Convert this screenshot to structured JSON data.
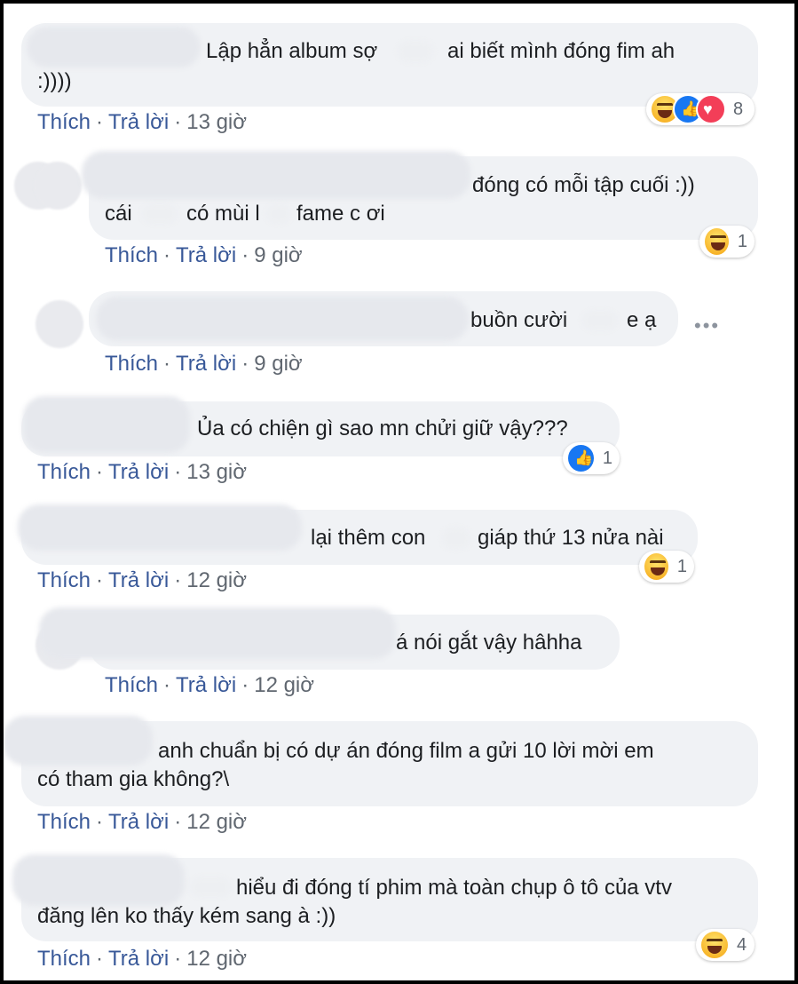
{
  "actions": {
    "like": "Thích",
    "reply": "Trả lời",
    "separator": "·"
  },
  "comments": [
    {
      "lines": [
        "Lập hẳn album sợ",
        "ai biết mình đóng fim ah",
        ":))))"
      ],
      "time": "13 giờ",
      "reactions": {
        "icons": [
          "haha",
          "like",
          "love"
        ],
        "count": "8"
      }
    },
    {
      "lines": [
        "đóng có mỗi tập cuối :))",
        "cái",
        "có mùi l",
        "fame c ơi"
      ],
      "time": "9 giờ",
      "reactions": {
        "icons": [
          "haha"
        ],
        "count": "1"
      }
    },
    {
      "lines": [
        "buồn cười",
        "e ạ"
      ],
      "time": "9 giờ",
      "more": "•••"
    },
    {
      "lines": [
        "Ủa có chiện gì sao mn chửi giữ vậy???"
      ],
      "time": "13 giờ",
      "reactions": {
        "icons": [
          "like"
        ],
        "count": "1"
      }
    },
    {
      "lines": [
        "lại thêm con",
        "giáp thứ 13 nửa nài"
      ],
      "time": "12 giờ",
      "reactions": {
        "icons": [
          "haha"
        ],
        "count": "1"
      }
    },
    {
      "lines": [
        "á nói gắt vậy hâhha"
      ],
      "time": "12 giờ"
    },
    {
      "lines": [
        "anh chuẩn bị có dự án đóng film a gửi 10 lời mời em",
        "có tham gia không?\\"
      ],
      "time": "12 giờ"
    },
    {
      "lines": [
        "hiểu đi đóng tí phim mà toàn chụp ô tô của vtv",
        "đăng lên ko thấy kém sang à :))"
      ],
      "time": "12 giờ",
      "reactions": {
        "icons": [
          "haha"
        ],
        "count": "4"
      }
    }
  ]
}
